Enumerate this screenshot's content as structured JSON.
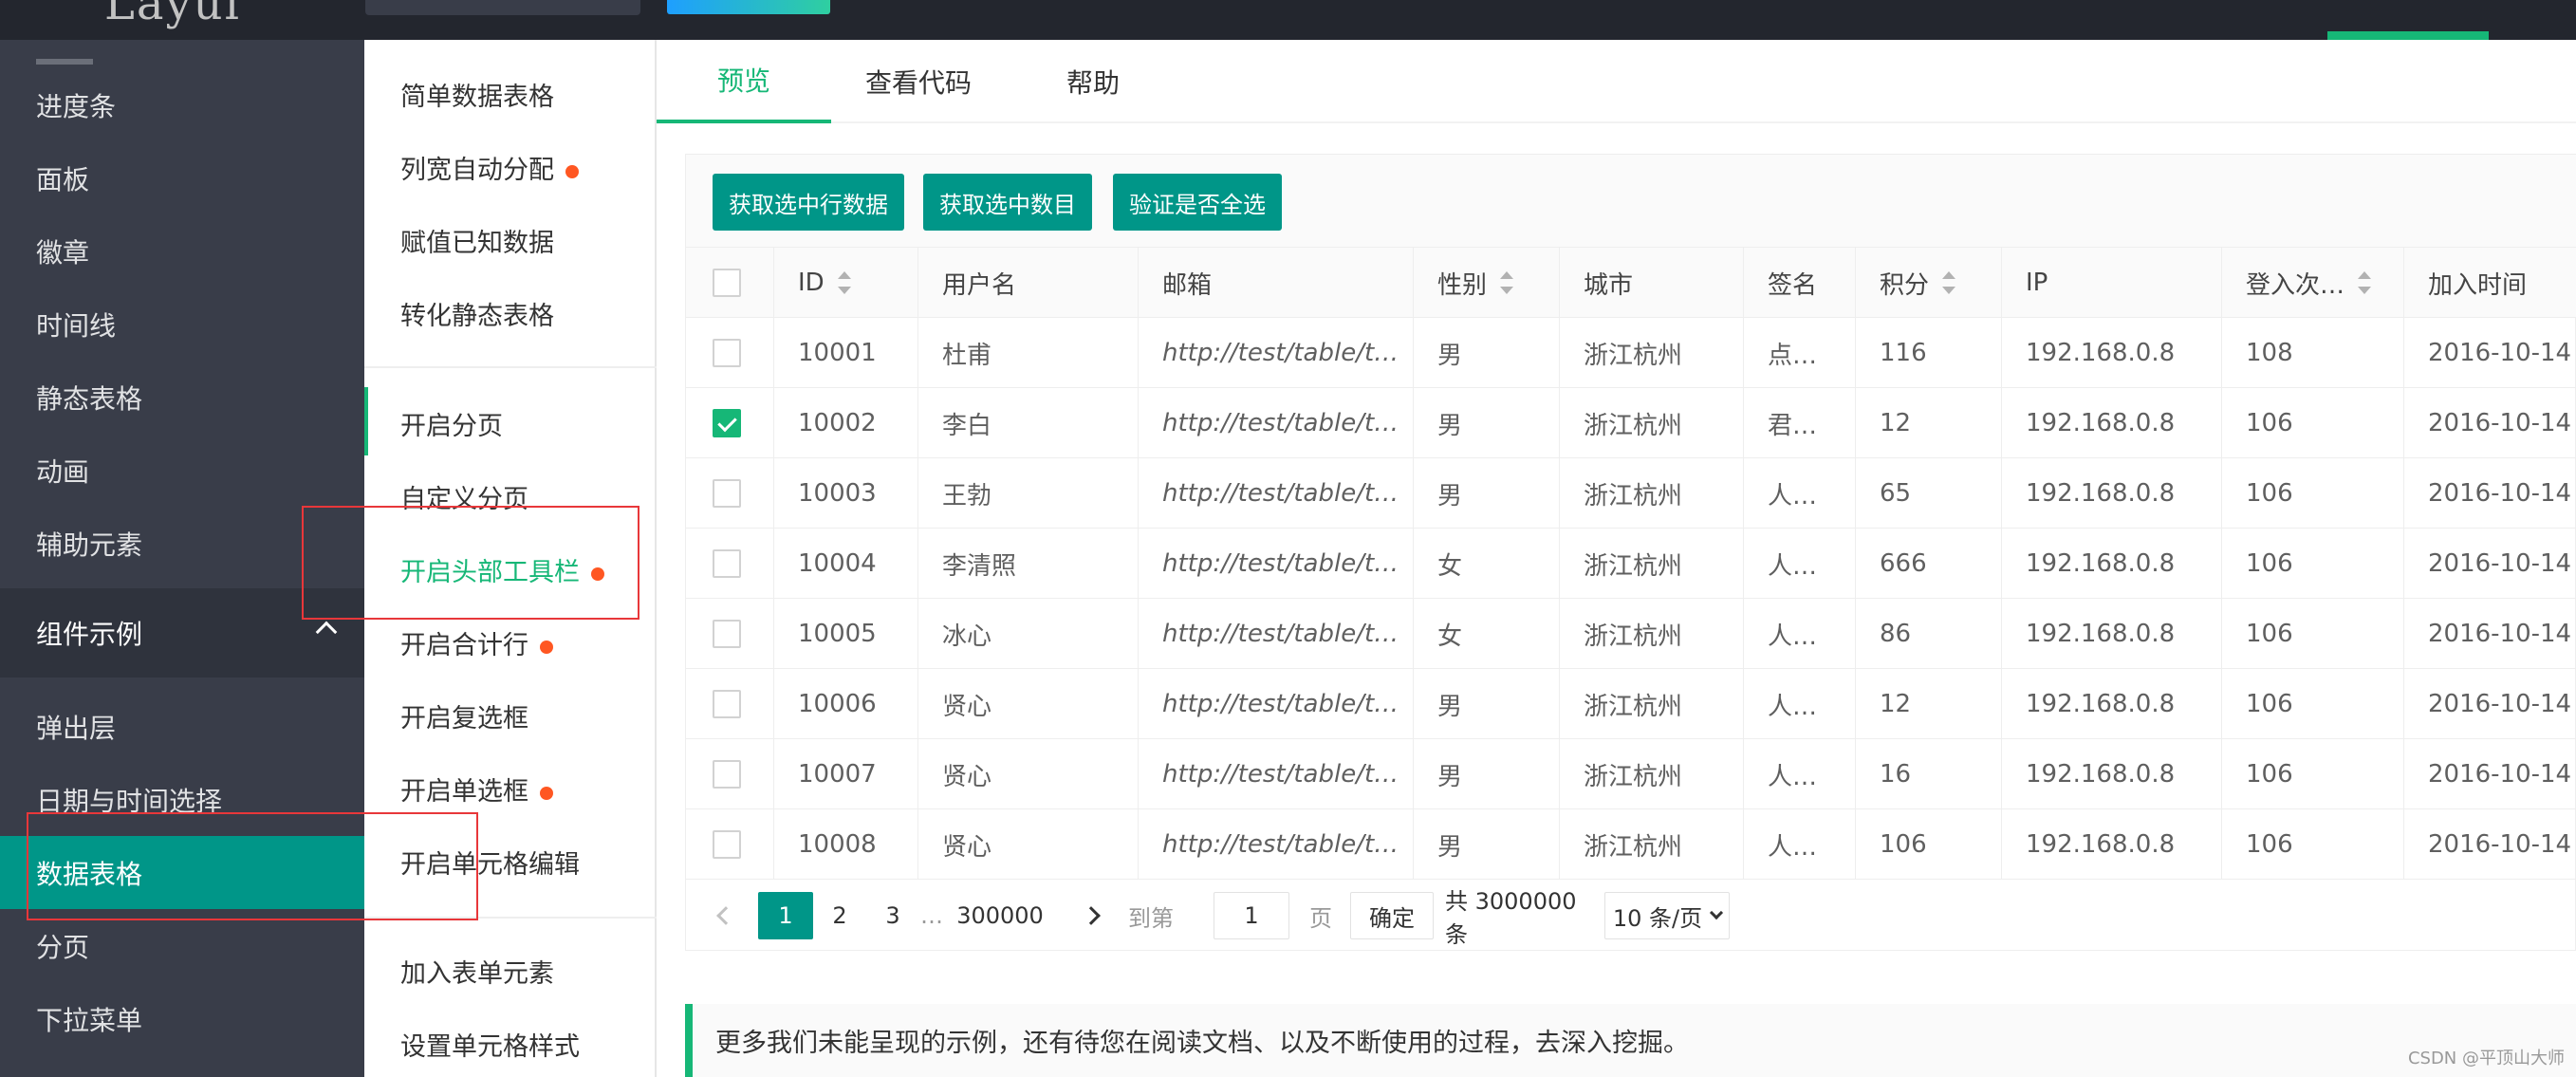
{
  "topbar": {
    "logo_text": "Layui"
  },
  "leftnav": {
    "items_top": [
      "进度条",
      "面板",
      "徽章",
      "时间线",
      "静态表格",
      "动画",
      "辅助元素"
    ],
    "group_label": "组件示例",
    "items_bottom": [
      "弹出层",
      "日期与时间选择",
      "数据表格",
      "分页",
      "下拉菜单"
    ]
  },
  "subnav": {
    "items": [
      "简单数据表格",
      "列宽自动分配",
      "赋值已知数据",
      "转化静态表格",
      "开启分页",
      "自定义分页",
      "开启头部工具栏",
      "开启合计行",
      "开启复选框",
      "开启单选框",
      "开启单元格编辑",
      "加入表单元素",
      "设置单元格样式"
    ]
  },
  "tabs": [
    "预览",
    "查看代码",
    "帮助"
  ],
  "toolbar": {
    "get_checked_data": "获取选中行数据",
    "get_checked_count": "获取选中数目",
    "check_all": "验证是否全选"
  },
  "table": {
    "columns": [
      "ID",
      "用户名",
      "邮箱",
      "性别",
      "城市",
      "签名",
      "积分",
      "IP",
      "登入次…",
      "加入时间"
    ],
    "rows": [
      [
        "10001",
        "杜甫",
        "http://test/table/t…",
        "男",
        "浙江杭州",
        "点…",
        "116",
        "192.168.0.8",
        "108",
        "2016-10-14"
      ],
      [
        "10002",
        "李白",
        "http://test/table/t…",
        "男",
        "浙江杭州",
        "君…",
        "12",
        "192.168.0.8",
        "106",
        "2016-10-14"
      ],
      [
        "10003",
        "王勃",
        "http://test/table/t…",
        "男",
        "浙江杭州",
        "人…",
        "65",
        "192.168.0.8",
        "106",
        "2016-10-14"
      ],
      [
        "10004",
        "李清照",
        "http://test/table/t…",
        "女",
        "浙江杭州",
        "人…",
        "666",
        "192.168.0.8",
        "106",
        "2016-10-14"
      ],
      [
        "10005",
        "冰心",
        "http://test/table/t…",
        "女",
        "浙江杭州",
        "人…",
        "86",
        "192.168.0.8",
        "106",
        "2016-10-14"
      ],
      [
        "10006",
        "贤心",
        "http://test/table/t…",
        "男",
        "浙江杭州",
        "人…",
        "12",
        "192.168.0.8",
        "106",
        "2016-10-14"
      ],
      [
        "10007",
        "贤心",
        "http://test/table/t…",
        "男",
        "浙江杭州",
        "人…",
        "16",
        "192.168.0.8",
        "106",
        "2016-10-14"
      ],
      [
        "10008",
        "贤心",
        "http://test/table/t…",
        "男",
        "浙江杭州",
        "人…",
        "106",
        "192.168.0.8",
        "106",
        "2016-10-14"
      ]
    ]
  },
  "pager": {
    "current": "1",
    "p2": "2",
    "p3": "3",
    "ellipsis": "…",
    "last": "300000",
    "goto_label": "到第",
    "goto_value": "1",
    "page_unit": "页",
    "confirm": "确定",
    "total": "共 3000000 条",
    "per_page": "10 条/页"
  },
  "tip": "更多我们未能呈现的示例，还有待您在阅读文档、以及不断使用的过程，去深入挖掘。",
  "watermark": "CSDN @平顶山大师",
  "colors": {
    "primary": "#009688",
    "accent_green": "#16b777",
    "dot": "#ff5722",
    "highlight_box": "#e8373a",
    "nav_bg": "#393d49"
  }
}
